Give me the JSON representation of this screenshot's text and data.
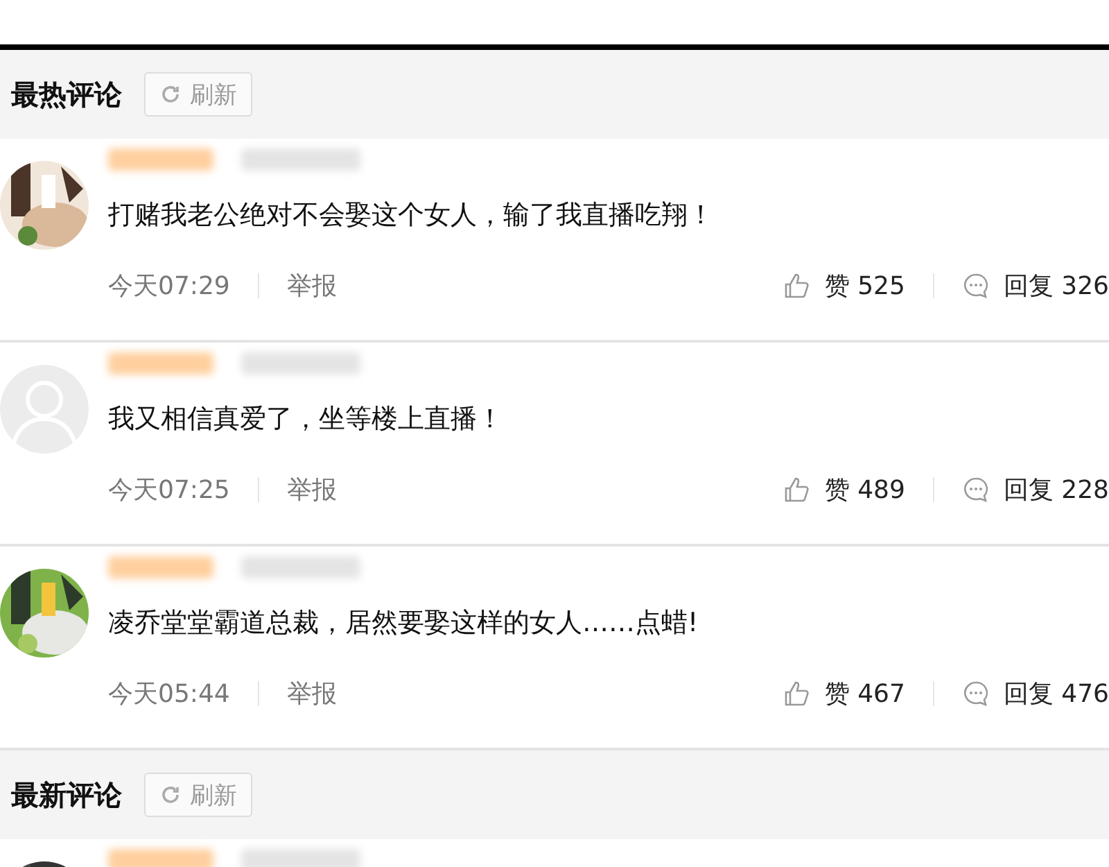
{
  "sections": [
    {
      "title": "最热评论",
      "refresh": "刷新",
      "comments": [
        {
          "text": "打赌我老公绝对不会娶这个女人，输了我直播吃翔！",
          "time": "今天07:29",
          "report": "举报",
          "like": "赞 525",
          "reply": "回复 326"
        },
        {
          "avatar": {
            "kind": "default"
          },
          "text": "我又相信真爱了，坐等楼上直播！",
          "time": "今天07:25",
          "report": "举报",
          "like": "赞 489",
          "reply": "回复 228"
        },
        {
          "text": "凌乔堂堂霸道总裁，居然要娶这样的女人……点蜡!",
          "time": "今天05:44",
          "report": "举报",
          "like": "赞 467",
          "reply": "回复 476"
        }
      ]
    },
    {
      "title": "最新评论",
      "refresh": "刷新"
    }
  ]
}
